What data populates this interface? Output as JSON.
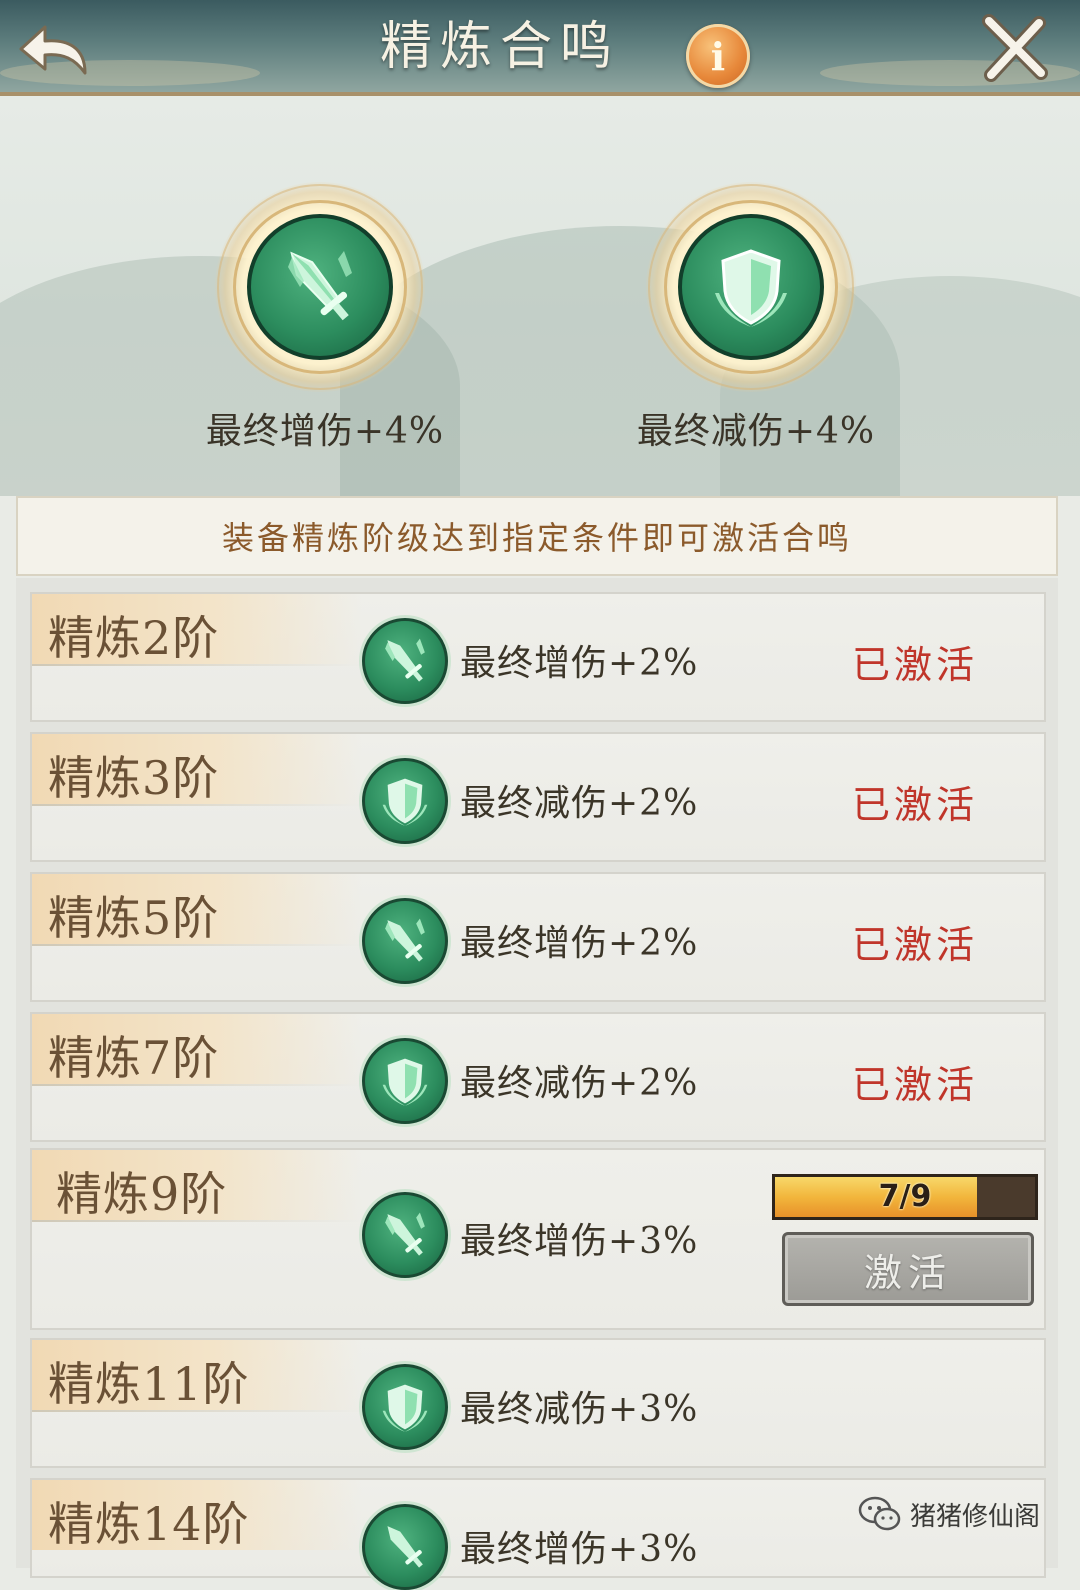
{
  "header": {
    "title": "精炼合鸣",
    "info_icon": "info-icon",
    "back_icon": "back-arrow-icon",
    "close_icon": "close-icon"
  },
  "summary": [
    {
      "icon": "sword-icon",
      "label": "最终增伤+4%"
    },
    {
      "icon": "shield-icon",
      "label": "最终减伤+4%"
    }
  ],
  "hint": "装备精炼阶级达到指定条件即可激活合鸣",
  "tiers": [
    {
      "label": "精炼2阶",
      "icon": "sword-icon",
      "effect": "最终增伤+2%",
      "status": "已激活"
    },
    {
      "label": "精炼3阶",
      "icon": "shield-icon",
      "effect": "最终减伤+2%",
      "status": "已激活"
    },
    {
      "label": "精炼5阶",
      "icon": "sword-icon",
      "effect": "最终增伤+2%",
      "status": "已激活"
    },
    {
      "label": "精炼7阶",
      "icon": "shield-icon",
      "effect": "最终减伤+2%",
      "status": "已激活"
    },
    {
      "label": "精炼9阶",
      "icon": "sword-icon",
      "effect": "最终增伤+3%",
      "progress_text": "7/9",
      "progress_fraction": 0.778,
      "button": "激活"
    },
    {
      "label": "精炼11阶",
      "icon": "shield-icon",
      "effect": "最终减伤+3%"
    },
    {
      "label": "精炼14阶",
      "icon": "sword-icon",
      "effect": "最终增伤+3%"
    }
  ],
  "watermark": "猪猪修仙阁",
  "colors": {
    "accent_green": "#2c8d5e",
    "status_red": "#c0352a",
    "progress_orange": "#f2b63c",
    "title_brown": "#6a5136"
  }
}
